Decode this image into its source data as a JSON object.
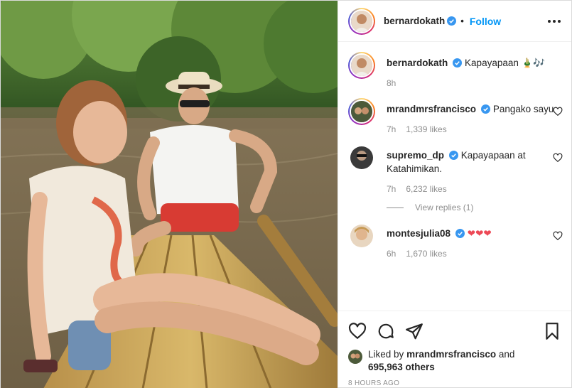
{
  "header": {
    "username": "bernardokath",
    "separator": "•",
    "follow_label": "Follow"
  },
  "caption": {
    "username": "bernardokath",
    "text": "Kapayapaan 🎍🎶",
    "time": "8h"
  },
  "comments": [
    {
      "username": "mrandmrsfrancisco",
      "text": "Pangako sayu",
      "time": "7h",
      "likes": "1,339 likes",
      "verified": true
    },
    {
      "username": "supremo_dp",
      "text": "Kapayapaan at Katahimikan.",
      "time": "7h",
      "likes": "6,232 likes",
      "verified": true,
      "view_replies": "View replies (1)"
    },
    {
      "username": "montesjulia08",
      "text": "❤❤❤",
      "time": "6h",
      "likes": "1,670 likes",
      "verified": true
    }
  ],
  "likes": {
    "prefix": "Liked by",
    "user": "mrandmrsfrancisco",
    "middle": "and",
    "count": "695,963 others"
  },
  "timestamp": "8 HOURS AGO",
  "colors": {
    "link": "#0095f6",
    "verified": "#3897f0",
    "heart": "#ed4956"
  },
  "icons": [
    "more-options-icon",
    "verified-icon",
    "heart-icon",
    "comment-icon",
    "share-icon",
    "bookmark-icon"
  ]
}
